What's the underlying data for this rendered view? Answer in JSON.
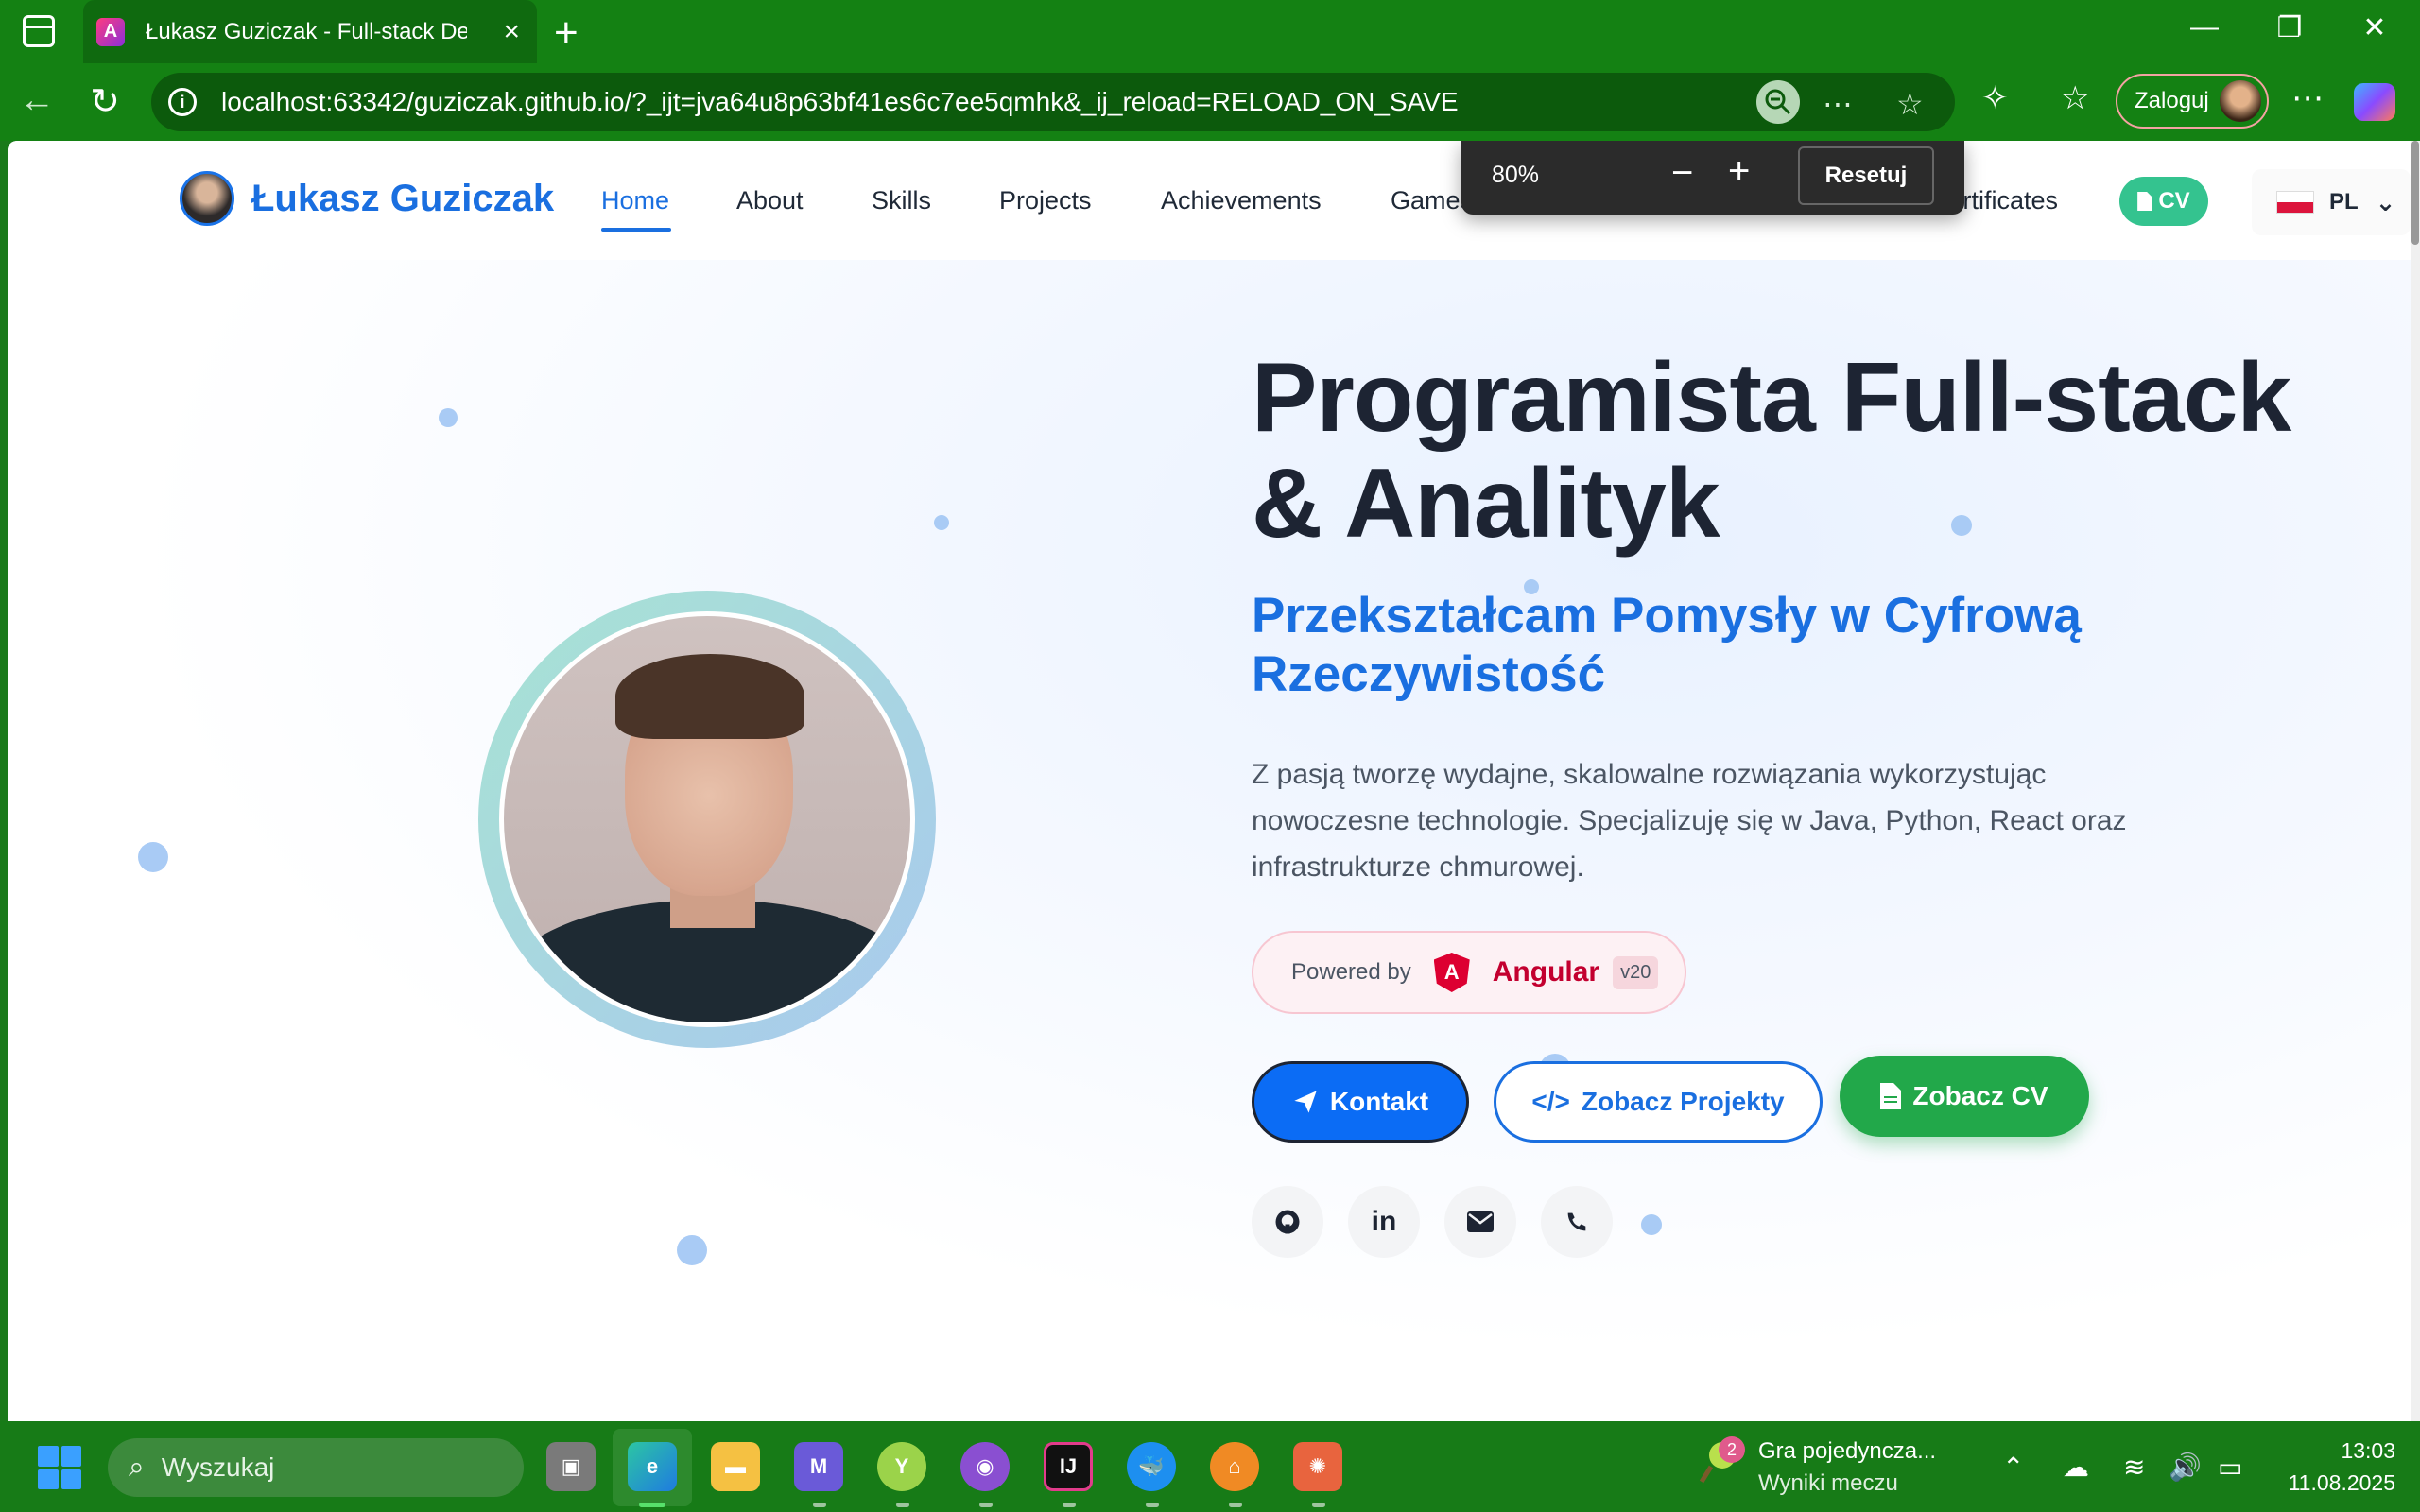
{
  "browser": {
    "tab_title": "Łukasz Guziczak - Full-stack Devel",
    "url": "localhost:63342/guziczak.github.io/?_ijt=jva64u8p63bf41es6c7ee5qmhk&_ij_reload=RELOAD_ON_SAVE",
    "profile_label": "Zaloguj",
    "zoom_popup": {
      "level": "80%",
      "reset_label": "Resetuj"
    }
  },
  "site": {
    "brand_name": "Łukasz Guziczak",
    "nav": [
      {
        "label": "Home",
        "active": true
      },
      {
        "label": "About"
      },
      {
        "label": "Skills"
      },
      {
        "label": "Projects"
      },
      {
        "label": "Achievements"
      },
      {
        "label": "Games"
      },
      {
        "label": "Certificates"
      }
    ],
    "cv_pill_label": "CV",
    "language": "PL"
  },
  "hero": {
    "headline": "Programista Full-stack & Analityk",
    "subhead": "Przekształcam Pomysły w Cyfrową Rzeczywistość",
    "description": "Z pasją tworzę wydajne, skalowalne rozwiązania wykorzystując nowoczesne technologie. Specjalizuję się w Java, Python, React oraz infrastrukturze chmurowej.",
    "powered": {
      "label": "Powered by",
      "framework": "Angular",
      "version": "v20"
    },
    "buttons": {
      "contact": "Kontakt",
      "projects": "Zobacz Projekty",
      "cv": "Zobacz CV"
    },
    "social_icons": [
      "github-icon",
      "linkedin-icon",
      "envelope-icon",
      "phone-icon"
    ]
  },
  "taskbar": {
    "search_placeholder": "Wyszukaj",
    "notification": {
      "badge": "2",
      "title": "Gra pojedyncza...",
      "subtitle": "Wyniki meczu"
    },
    "time": "13:03",
    "date": "11.08.2025"
  },
  "colors": {
    "accent": "#1a6fe0",
    "browser_frame": "#148113",
    "angular_red": "#dd0031",
    "cv_green": "#22a84a"
  }
}
